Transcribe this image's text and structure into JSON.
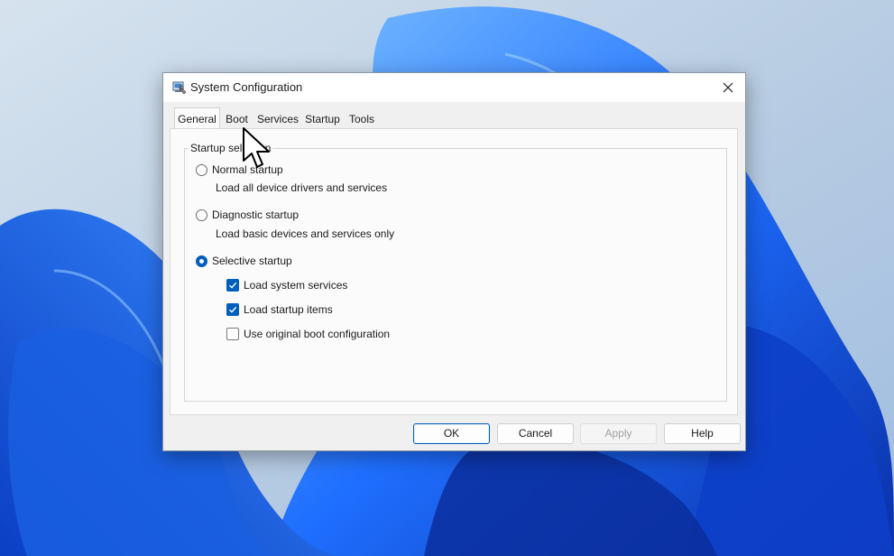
{
  "dialog": {
    "title": "System Configuration",
    "tabs": [
      {
        "label": "General",
        "active": true
      },
      {
        "label": "Boot",
        "active": false
      },
      {
        "label": "Services",
        "active": false
      },
      {
        "label": "Startup",
        "active": false
      },
      {
        "label": "Tools",
        "active": false
      }
    ],
    "group_label": "Startup selection",
    "options": [
      {
        "label": "Normal startup",
        "description": "Load all device drivers and services",
        "selected": false
      },
      {
        "label": "Diagnostic startup",
        "description": "Load basic devices and services only",
        "selected": false
      },
      {
        "label": "Selective startup",
        "selected": true
      }
    ],
    "checkboxes": [
      {
        "label": "Load system services",
        "checked": true
      },
      {
        "label": "Load startup items",
        "checked": true
      },
      {
        "label": "Use original boot configuration",
        "checked": false
      }
    ],
    "buttons": {
      "ok": "OK",
      "cancel": "Cancel",
      "apply": "Apply",
      "help": "Help"
    }
  },
  "icons": [
    "msconfig-app-icon",
    "close-icon",
    "mouse-pointer-icon"
  ],
  "colors": {
    "accent": "#005fb8",
    "wallpaper_blue": "#1a5fe0"
  }
}
